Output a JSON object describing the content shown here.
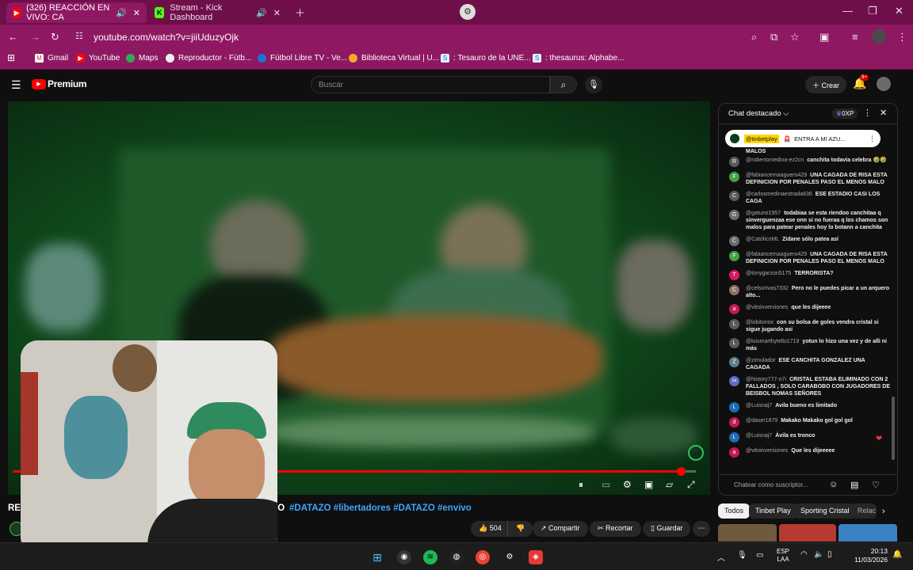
{
  "browser": {
    "tabs": [
      {
        "title": "(326) REACCIÓN EN VIVO: CA",
        "active": true
      },
      {
        "title": "Stream - Kick Dashboard",
        "active": false
      }
    ],
    "url": "youtube.com/watch?v=jiiUduzyOjk",
    "bookmarks": [
      "Gmail",
      "YouTube",
      "Maps",
      "Reproductor - Fútb...",
      "Fútbol Libre TV - Ve...",
      "Biblioteca Virtual | U...",
      ": Tesauro de la UNE...",
      ": thesaurus: Alphabe..."
    ]
  },
  "youtube": {
    "logo": "Premium",
    "search_placeholder": "Buscar",
    "create_label": "Crear",
    "notifications": "9+"
  },
  "player": {
    "progress_fraction": 0.978
  },
  "video": {
    "title_prefix": "REA",
    "title_tail": "RO",
    "hashtags": "#DATAZO #libertadores #DATAZO #envivo",
    "likes": "504",
    "share_label": "Compartir",
    "clip_label": "Recortar",
    "save_label": "Guardar"
  },
  "chat": {
    "header": "Chat destacado",
    "points": "0XP",
    "pinned_user": "@tinbetplay",
    "pinned_text": "ENTRA A MI AZU...",
    "partial_top": "MALOS",
    "input_placeholder": "Chatear como suscriptor...",
    "messages": [
      {
        "author": "@robertomedina-ez2cn",
        "text": "canchita todavia celebra 🤣🤣",
        "color": "#5a5a5a",
        "initial": "R"
      },
      {
        "author": "@fabiancernaaguero429",
        "text": "UNA CAGADA DE RISA ESTA DEFINICION POR PENALES PASO EL MENOS MALO",
        "color": "#43a047",
        "initial": "F"
      },
      {
        "author": "@carlosmedinaestrada836",
        "text": "ESE ESTADIO CASI LOS CAGA",
        "color": "#5a5a5a",
        "initial": "C"
      },
      {
        "author": "@gatuno1957",
        "text": "todabiaa se esta riendoo canchitaa q sinverguenzaa ese onn si no fueraa q los chamos son malos para patear penales hoy lo botann a canchita",
        "color": "#6d6d6d",
        "initial": "G"
      },
      {
        "author": "@CatólicoML",
        "text": "Zidane sólo patea así",
        "color": "#6d6d6d",
        "initial": "C"
      },
      {
        "author": "@fabiancernaaguero429",
        "text": "UNA CAGADA DE RISA ESTA DEFINICION POR PENALES PASO EL MENOS MALO",
        "color": "#43a047",
        "initial": "F"
      },
      {
        "author": "@tonygarzon5175",
        "text": "TERRORISTA?",
        "color": "#d81b60",
        "initial": "T"
      },
      {
        "author": "@celsorivas7332",
        "text": "Pero no le puedes picar a un arquero alto...",
        "color": "#8d6e63",
        "initial": "C"
      },
      {
        "author": "@vitoinversiones",
        "text": "que les dijeeee",
        "color": "#c2185b",
        "initial": "a"
      },
      {
        "author": "@lobitonox",
        "text": "con su bolsa de goles vendra cristal si sigue jugando asi",
        "color": "#5a5a5a",
        "initial": "L"
      },
      {
        "author": "@luismarthytello1719",
        "text": "yotun lo hizo una vez y de alli ni más",
        "color": "#5a5a5a",
        "initial": "L"
      },
      {
        "author": "@zimulador",
        "text": "ESE CANCHITA GONZALEZ UNA CAGADA",
        "color": "#607d8b",
        "initial": "Z"
      },
      {
        "author": "@history777-o7i",
        "text": "CRISTAL ESTABA ELIMINADO CON 2 FALLADOS , SOLO CARABOBO CON JUGADORES DE BEISBOL NOMAS SEÑORES",
        "color": "#5c6bc0",
        "initial": "H"
      },
      {
        "author": "@Luisnaj7",
        "text": "Avila bueno es limitado",
        "color": "#1e6bb8",
        "initial": "L"
      },
      {
        "author": "@daser1879",
        "text": "Makako Makako gol gol gol",
        "color": "#c2185b",
        "initial": "d"
      },
      {
        "author": "@Luisnaj7",
        "text": "Ávila es tronco",
        "color": "#1e6bb8",
        "initial": "L"
      },
      {
        "author": "@vitoinversiones",
        "text": "Que les dijeeeee",
        "color": "#c2185b",
        "initial": "a"
      }
    ]
  },
  "chips": [
    "Todos",
    "Tinbet Play",
    "Sporting Cristal",
    "Relac"
  ],
  "taskbar": {
    "lang1": "ESP",
    "lang2": "LAA",
    "time": "20:13",
    "date": "11/03/2026"
  }
}
